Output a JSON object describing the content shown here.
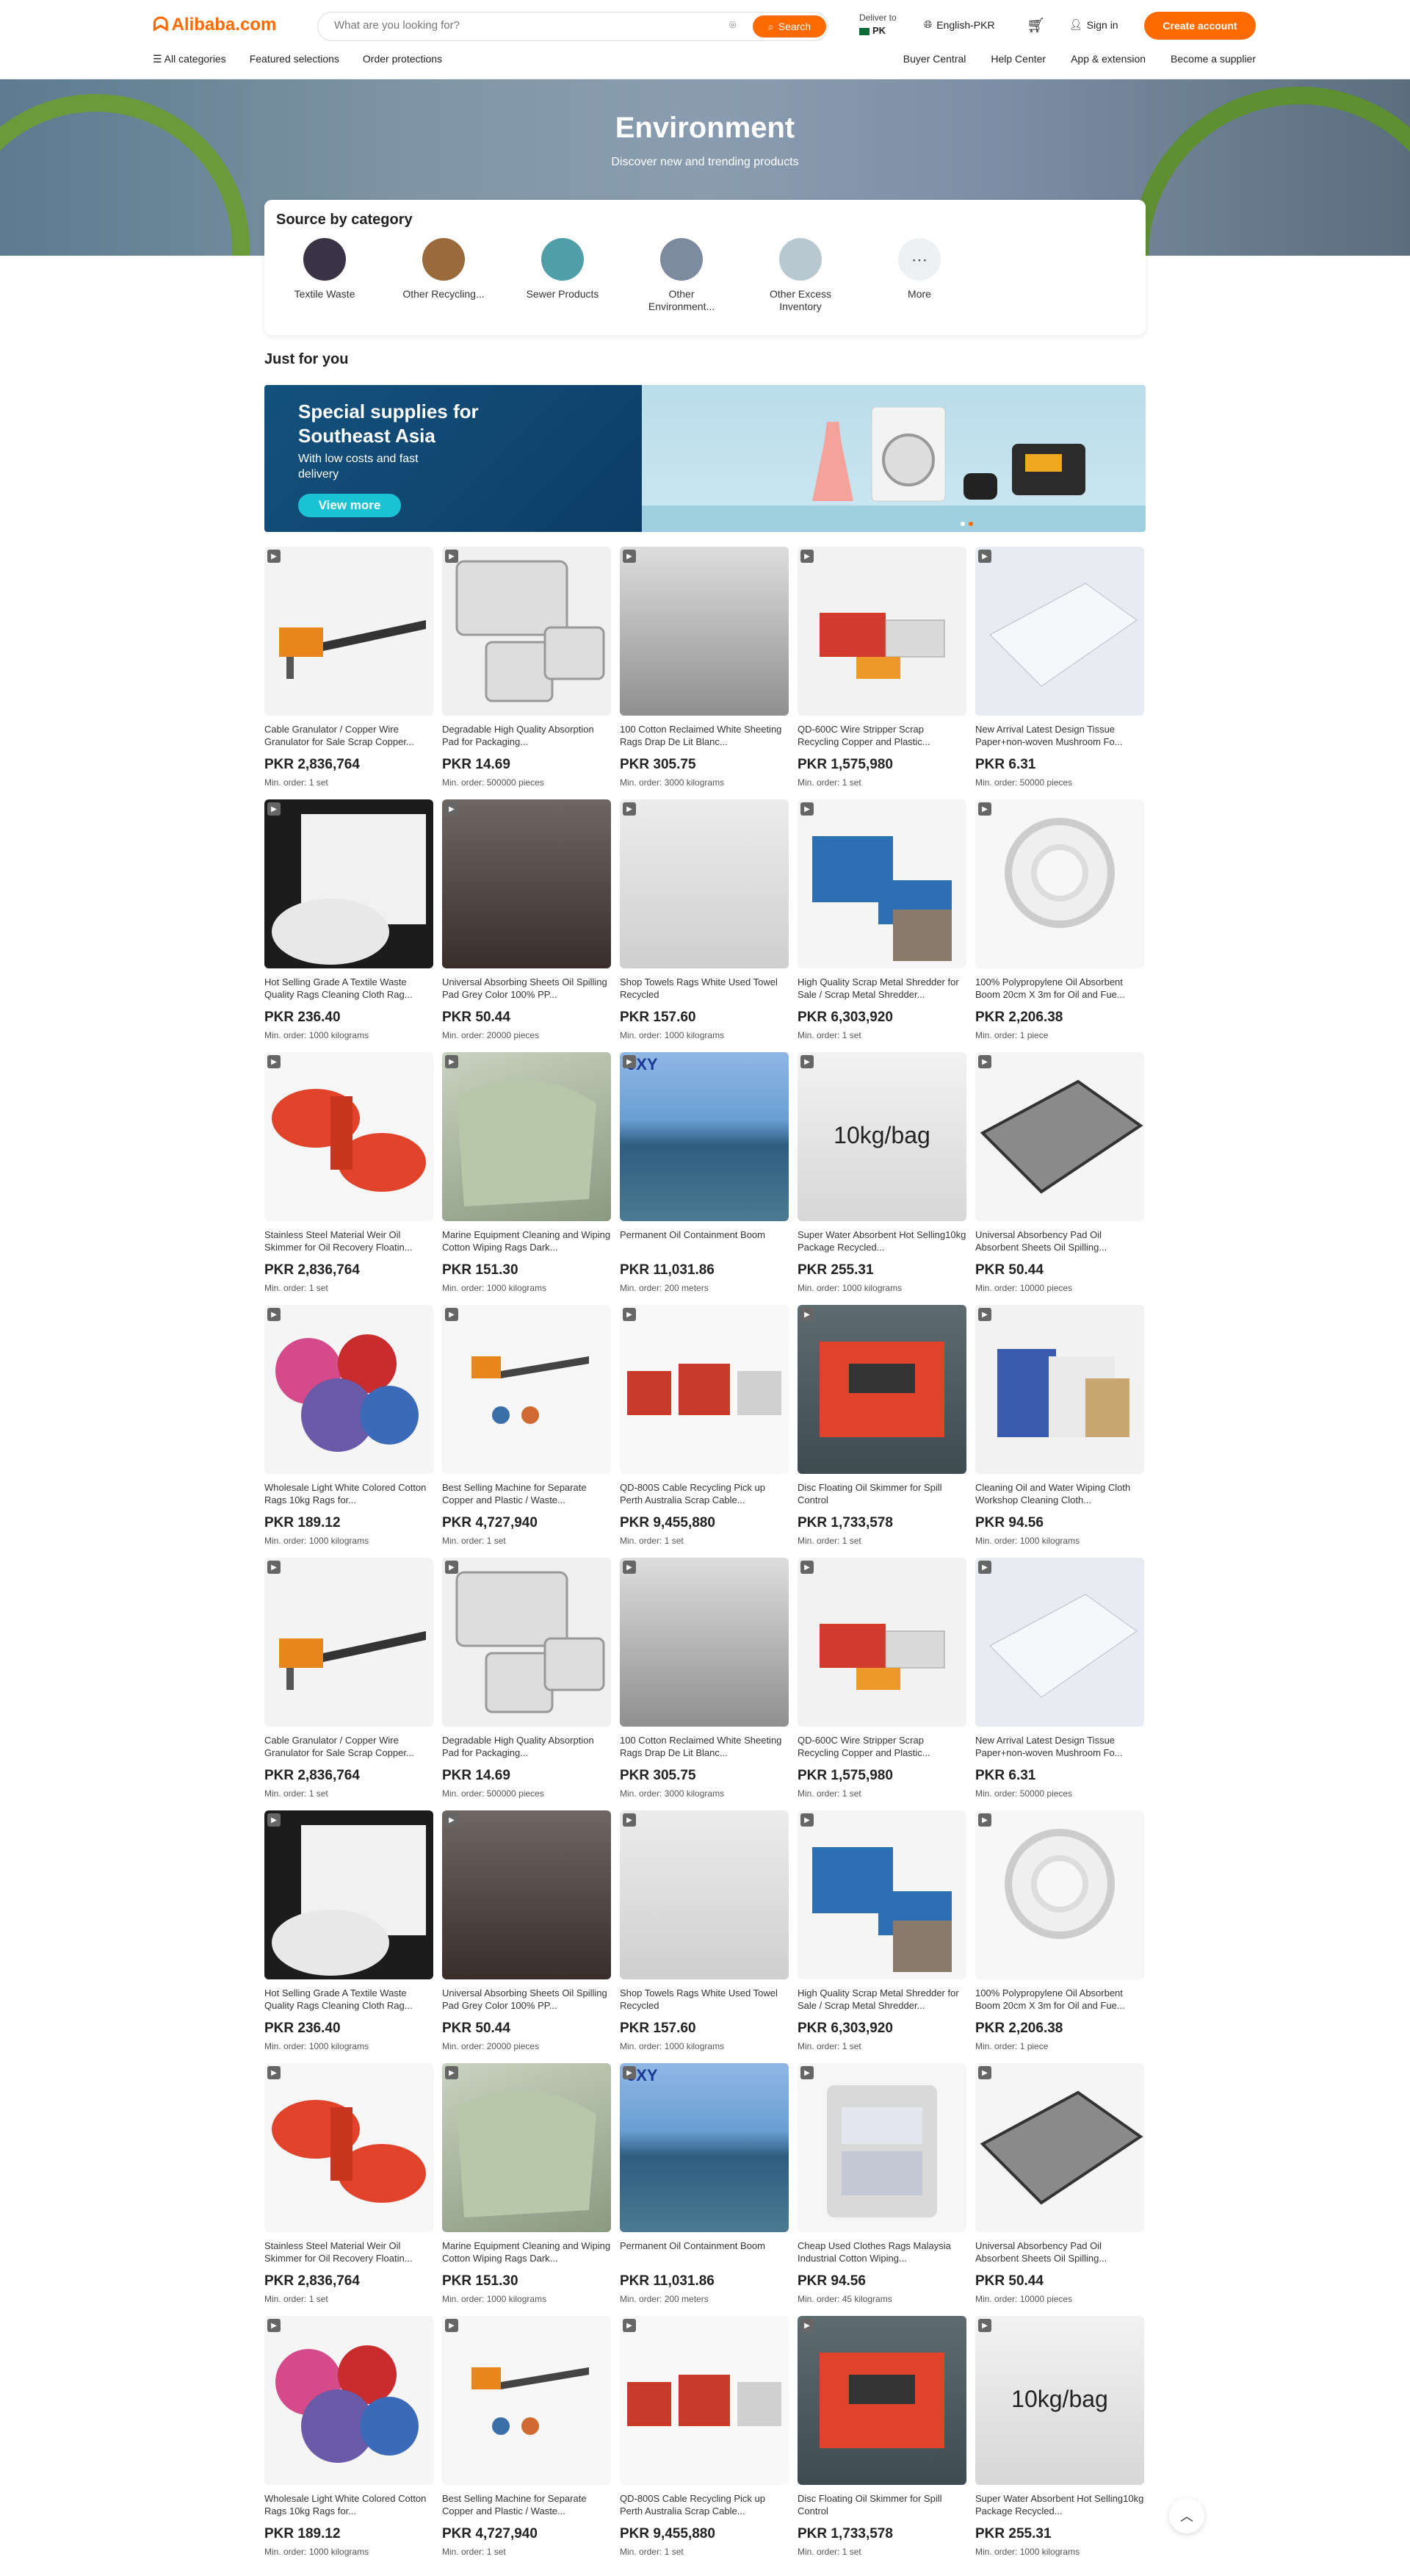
{
  "header": {
    "logo_text": "Alibaba.com",
    "search_placeholder": "What are you looking for?",
    "search_button": "Search",
    "deliver_label": "Deliver to",
    "deliver_country": "PK",
    "language": "English-PKR",
    "signin": "Sign in",
    "create_account": "Create account",
    "nav_left": [
      "All categories",
      "Featured selections",
      "Order protections"
    ],
    "nav_right": [
      "Buyer Central",
      "Help Center",
      "App & extension",
      "Become a supplier"
    ]
  },
  "hero": {
    "title": "Environment",
    "subtitle": "Discover new and trending products"
  },
  "categories": {
    "title": "Source by category",
    "items": [
      "Textile Waste",
      "Other Recycling...",
      "Sewer Products",
      "Other Environment...",
      "Other Excess Inventory",
      "More"
    ]
  },
  "just_for_you": "Just for you",
  "banner": {
    "title": "Special supplies for Southeast Asia",
    "subtitle": "With low costs and fast delivery",
    "button": "View more"
  },
  "products": [
    {
      "title": "Cable Granulator / Copper Wire Granulator for Sale Scrap Copper...",
      "price": "PKR 2,836,764",
      "moq_prefix": "Min. order: ",
      "moq": "1 set",
      "img": "machine-orange"
    },
    {
      "title": "Degradable High Quality Absorption Pad for Packaging...",
      "price": "PKR 14.69",
      "moq_prefix": "Min. order: ",
      "moq": "500000 pieces",
      "img": "trays"
    },
    {
      "title": "100 Cotton Reclaimed White Sheeting Rags Drap De Lit Blanc...",
      "price": "PKR 305.75",
      "moq_prefix": "Min. order: ",
      "moq": "3000 kilograms",
      "img": "bales-grey"
    },
    {
      "title": "QD-600C Wire Stripper Scrap Recycling Copper and Plastic...",
      "price": "PKR 1,575,980",
      "moq_prefix": "Min. order: ",
      "moq": "1 set",
      "img": "machine-red"
    },
    {
      "title": "New Arrival Latest Design Tissue Paper+non-woven Mushroom Fo...",
      "price": "PKR 6.31",
      "moq_prefix": "Min. order: ",
      "moq": "50000 pieces",
      "img": "pad-white"
    },
    {
      "title": "Hot Selling Grade A Textile Waste Quality Rags Cleaning Cloth Rag...",
      "price": "PKR 236.40",
      "moq_prefix": "Min. order: ",
      "moq": "1000 kilograms",
      "img": "rags-box"
    },
    {
      "title": "Universal Absorbing Sheets Oil Spilling Pad Grey Color 100% PP...",
      "price": "PKR 50.44",
      "moq_prefix": "Min. order: ",
      "moq": "20000 pieces",
      "img": "sheets-dark"
    },
    {
      "title": "Shop Towels Rags White Used Towel Recycled",
      "price": "PKR 157.60",
      "moq_prefix": "Min. order: ",
      "moq": "1000 kilograms",
      "img": "towels"
    },
    {
      "title": "High Quality Scrap Metal Shredder for Sale / Scrap Metal Shredder...",
      "price": "PKR 6,303,920",
      "moq_prefix": "Min. order: ",
      "moq": "1 set",
      "img": "machine-blue"
    },
    {
      "title": "100% Polypropylene Oil Absorbent Boom 20cm X 3m for Oil and Fue...",
      "price": "PKR 2,206.38",
      "moq_prefix": "Min. order: ",
      "moq": "1 piece",
      "img": "boom-white"
    },
    {
      "title": "Stainless Steel Material Weir Oil Skimmer for Oil Recovery Floatin...",
      "price": "PKR 2,836,764",
      "moq_prefix": "Min. order: ",
      "moq": "1 set",
      "img": "skimmer-red"
    },
    {
      "title": "Marine Equipment Cleaning and Wiping Cotton Wiping Rags Dark...",
      "price": "PKR 151.30",
      "moq_prefix": "Min. order: ",
      "moq": "1000 kilograms",
      "img": "rags-green"
    },
    {
      "title": "Permanent Oil Containment Boom",
      "price": "PKR 11,031.86",
      "moq_prefix": "Min. order: ",
      "moq": "200 meters",
      "img": "sea",
      "img_text": "JXY"
    },
    {
      "title": "Super Water Absorbent Hot Selling10kg Package Recycled...",
      "price": "PKR 255.31",
      "moq_prefix": "Min. order: ",
      "moq": "1000 kilograms",
      "img": "bag",
      "img_text": "10kg/bag"
    },
    {
      "title": "Universal Absorbency Pad Oil Absorbent Sheets Oil Spilling...",
      "price": "PKR 50.44",
      "moq_prefix": "Min. order: ",
      "moq": "10000 pieces",
      "img": "pad-grey"
    },
    {
      "title": "Wholesale Light White Colored Cotton Rags 10kg Rags for...",
      "price": "PKR 189.12",
      "moq_prefix": "Min. order: ",
      "moq": "1000 kilograms",
      "img": "rags-colored"
    },
    {
      "title": "Best Selling Machine for Separate Copper and Plastic / Waste...",
      "price": "PKR 4,727,940",
      "moq_prefix": "Min. order: ",
      "moq": "1 set",
      "img": "machine-orange2"
    },
    {
      "title": "QD-800S Cable Recycling Pick up Perth Australia Scrap Cable...",
      "price": "PKR 9,455,880",
      "moq_prefix": "Min. order: ",
      "moq": "1 set",
      "img": "machine-line"
    },
    {
      "title": "Disc Floating Oil Skimmer for Spill Control",
      "price": "PKR 1,733,578",
      "moq_prefix": "Min. order: ",
      "moq": "1 set",
      "img": "disc-red"
    },
    {
      "title": "Cleaning Oil and Water Wiping Cloth Workshop Cleaning Cloth...",
      "price": "PKR 94.56",
      "moq_prefix": "Min. order: ",
      "moq": "1000 kilograms",
      "img": "bags-mixed"
    },
    {
      "title": "Cable Granulator / Copper Wire Granulator for Sale Scrap Copper...",
      "price": "PKR 2,836,764",
      "moq_prefix": "Min. order: ",
      "moq": "1 set",
      "img": "machine-orange"
    },
    {
      "title": "Degradable High Quality Absorption Pad for Packaging...",
      "price": "PKR 14.69",
      "moq_prefix": "Min. order: ",
      "moq": "500000 pieces",
      "img": "trays"
    },
    {
      "title": "100 Cotton Reclaimed White Sheeting Rags Drap De Lit Blanc...",
      "price": "PKR 305.75",
      "moq_prefix": "Min. order: ",
      "moq": "3000 kilograms",
      "img": "bales-grey"
    },
    {
      "title": "QD-600C Wire Stripper Scrap Recycling Copper and Plastic...",
      "price": "PKR 1,575,980",
      "moq_prefix": "Min. order: ",
      "moq": "1 set",
      "img": "machine-red"
    },
    {
      "title": "New Arrival Latest Design Tissue Paper+non-woven Mushroom Fo...",
      "price": "PKR 6.31",
      "moq_prefix": "Min. order: ",
      "moq": "50000 pieces",
      "img": "pad-white"
    },
    {
      "title": "Hot Selling Grade A Textile Waste Quality Rags Cleaning Cloth Rag...",
      "price": "PKR 236.40",
      "moq_prefix": "Min. order: ",
      "moq": "1000 kilograms",
      "img": "rags-box"
    },
    {
      "title": "Universal Absorbing Sheets Oil Spilling Pad Grey Color 100% PP...",
      "price": "PKR 50.44",
      "moq_prefix": "Min. order: ",
      "moq": "20000 pieces",
      "img": "sheets-dark"
    },
    {
      "title": "Shop Towels Rags White Used Towel Recycled",
      "price": "PKR 157.60",
      "moq_prefix": "Min. order: ",
      "moq": "1000 kilograms",
      "img": "towels"
    },
    {
      "title": "High Quality Scrap Metal Shredder for Sale / Scrap Metal Shredder...",
      "price": "PKR 6,303,920",
      "moq_prefix": "Min. order: ",
      "moq": "1 set",
      "img": "machine-blue"
    },
    {
      "title": "100% Polypropylene Oil Absorbent Boom 20cm X 3m for Oil and Fue...",
      "price": "PKR 2,206.38",
      "moq_prefix": "Min. order: ",
      "moq": "1 piece",
      "img": "boom-white"
    },
    {
      "title": "Stainless Steel Material Weir Oil Skimmer for Oil Recovery Floatin...",
      "price": "PKR 2,836,764",
      "moq_prefix": "Min. order: ",
      "moq": "1 set",
      "img": "skimmer-red"
    },
    {
      "title": "Marine Equipment Cleaning and Wiping Cotton Wiping Rags Dark...",
      "price": "PKR 151.30",
      "moq_prefix": "Min. order: ",
      "moq": "1000 kilograms",
      "img": "rags-green"
    },
    {
      "title": "Permanent Oil Containment Boom",
      "price": "PKR 11,031.86",
      "moq_prefix": "Min. order: ",
      "moq": "200 meters",
      "img": "sea",
      "img_text": "JXY"
    },
    {
      "title": "Cheap Used Clothes Rags Malaysia Industrial Cotton Wiping...",
      "price": "PKR 94.56",
      "moq_prefix": "Min. order: ",
      "moq": "45 kilograms",
      "img": "bale-clothes"
    },
    {
      "title": "Universal Absorbency Pad Oil Absorbent Sheets Oil Spilling...",
      "price": "PKR 50.44",
      "moq_prefix": "Min. order: ",
      "moq": "10000 pieces",
      "img": "pad-grey"
    },
    {
      "title": "Wholesale Light White Colored Cotton Rags 10kg Rags for...",
      "price": "PKR 189.12",
      "moq_prefix": "Min. order: ",
      "moq": "1000 kilograms",
      "img": "rags-colored"
    },
    {
      "title": "Best Selling Machine for Separate Copper and Plastic / Waste...",
      "price": "PKR 4,727,940",
      "moq_prefix": "Min. order: ",
      "moq": "1 set",
      "img": "machine-orange2"
    },
    {
      "title": "QD-800S Cable Recycling Pick up Perth Australia Scrap Cable...",
      "price": "PKR 9,455,880",
      "moq_prefix": "Min. order: ",
      "moq": "1 set",
      "img": "machine-line"
    },
    {
      "title": "Disc Floating Oil Skimmer for Spill Control",
      "price": "PKR 1,733,578",
      "moq_prefix": "Min. order: ",
      "moq": "1 set",
      "img": "disc-red"
    },
    {
      "title": "Super Water Absorbent Hot Selling10kg Package Recycled...",
      "price": "PKR 255.31",
      "moq_prefix": "Min. order: ",
      "moq": "1000 kilograms",
      "img": "bag",
      "img_text": "10kg/bag"
    }
  ],
  "colors": {
    "accent": "#ff6a00",
    "text": "#222222"
  }
}
